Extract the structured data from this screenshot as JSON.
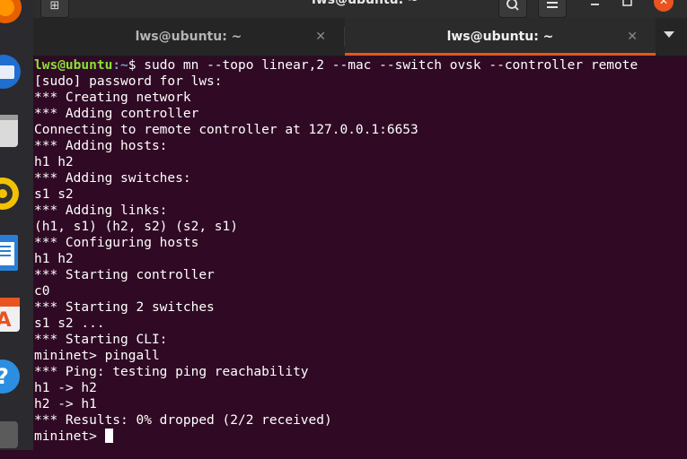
{
  "window": {
    "title": "lws@ubuntu: ~",
    "new_tab_icon": "new-tab-icon",
    "search_icon": "search-icon",
    "menu_icon": "hamburger-menu-icon",
    "minimize_icon": "minimize-icon",
    "maximize_icon": "maximize-icon",
    "close_icon": "close-icon",
    "accent_color": "#e95420"
  },
  "dock": {
    "items": [
      {
        "name": "firefox-icon"
      },
      {
        "name": "thunderbird-icon"
      },
      {
        "name": "files-icon"
      },
      {
        "name": "rhythmbox-icon"
      },
      {
        "name": "libreoffice-writer-icon"
      },
      {
        "name": "ubuntu-software-icon"
      },
      {
        "name": "help-icon"
      }
    ]
  },
  "tabs": [
    {
      "label": "lws@ubuntu: ~",
      "active": false
    },
    {
      "label": "lws@ubuntu: ~",
      "active": true
    }
  ],
  "terminal": {
    "prompt_user": "lws@ubuntu",
    "prompt_path": ":~",
    "prompt_symbol": "$ ",
    "command": "sudo mn --topo linear,2 --mac --switch ovsk --controller remote",
    "lines": [
      "[sudo] password for lws:",
      "*** Creating network",
      "*** Adding controller",
      "Connecting to remote controller at 127.0.0.1:6653",
      "*** Adding hosts:",
      "h1 h2",
      "*** Adding switches:",
      "s1 s2",
      "*** Adding links:",
      "(h1, s1) (h2, s2) (s2, s1)",
      "*** Configuring hosts",
      "h1 h2",
      "*** Starting controller",
      "c0",
      "*** Starting 2 switches",
      "s1 s2 ...",
      "*** Starting CLI:",
      "mininet> pingall",
      "*** Ping: testing ping reachability",
      "h1 -> h2",
      "h2 -> h1",
      "*** Results: 0% dropped (2/2 received)"
    ],
    "final_prompt": "mininet> ",
    "colors": {
      "background": "#300a24",
      "user": "#8ae234",
      "path": "#729fcf",
      "text": "#ffffff"
    }
  }
}
